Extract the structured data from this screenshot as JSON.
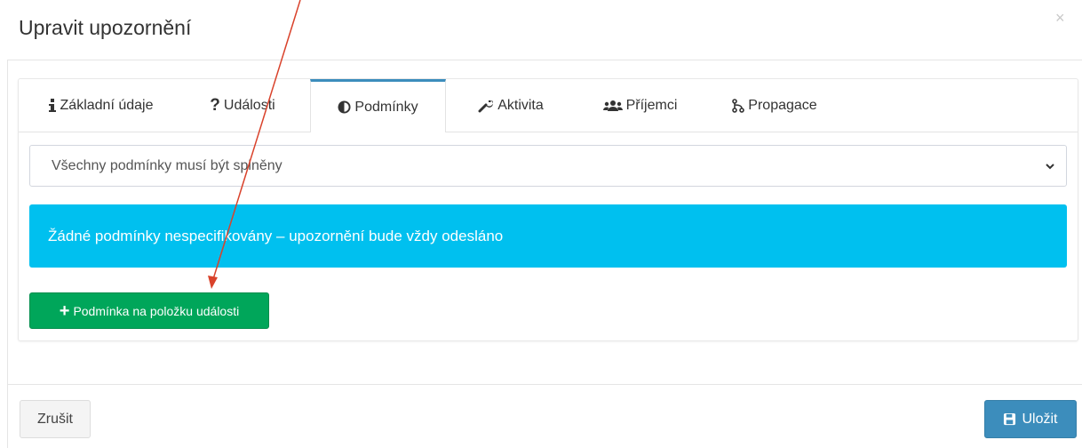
{
  "modal": {
    "title": "Upravit upozornění",
    "close_label": "×"
  },
  "tabs": [
    {
      "label": "Základní údaje",
      "icon": "info-icon"
    },
    {
      "label": "Události",
      "icon": "question-icon"
    },
    {
      "label": "Podmínky",
      "icon": "half-circle-icon",
      "active": true
    },
    {
      "label": "Aktivita",
      "icon": "wrench-icon"
    },
    {
      "label": "Příjemci",
      "icon": "users-icon"
    },
    {
      "label": "Propagace",
      "icon": "branch-icon"
    }
  ],
  "conditions": {
    "mode_select": {
      "value": "Všechny podmínky musí být splněny"
    },
    "empty_callout": "Žádné podmínky nespecifikovány – upozornění bude vždy odesláno",
    "add_button_label": "Podmínka na položku události"
  },
  "footer": {
    "cancel_label": "Zrušit",
    "save_label": "Uložit"
  },
  "colors": {
    "accent": "#3c8dbc",
    "callout": "#00c0ef",
    "success": "#00a65a",
    "annotation_arrow": "#d9422b"
  }
}
